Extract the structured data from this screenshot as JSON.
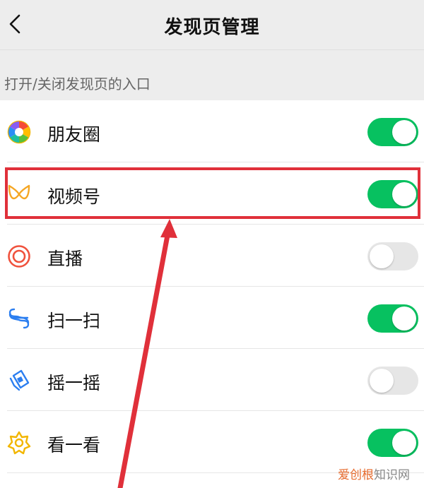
{
  "header": {
    "title": "发现页管理",
    "back_icon": "chevron-left-icon"
  },
  "section_label": "打开/关闭发现页的入口",
  "rows": [
    {
      "label": "朋友圈",
      "icon": "moments-aperture-icon",
      "enabled": true
    },
    {
      "label": "视频号",
      "icon": "channels-butterfly-icon",
      "enabled": true
    },
    {
      "label": "直播",
      "icon": "live-ring-icon",
      "enabled": false
    },
    {
      "label": "扫一扫",
      "icon": "scan-icon",
      "enabled": true
    },
    {
      "label": "摇一摇",
      "icon": "shake-phone-icon",
      "enabled": false
    },
    {
      "label": "看一看",
      "icon": "top-stories-star-icon",
      "enabled": true
    }
  ],
  "annotation": {
    "highlight_color": "#e0303a"
  },
  "colors": {
    "toggle_on": "#07c160",
    "toggle_off": "#e6e6e6",
    "background": "#ededed"
  },
  "watermark": {
    "part1": "爱创根",
    "part2": "知识网"
  }
}
